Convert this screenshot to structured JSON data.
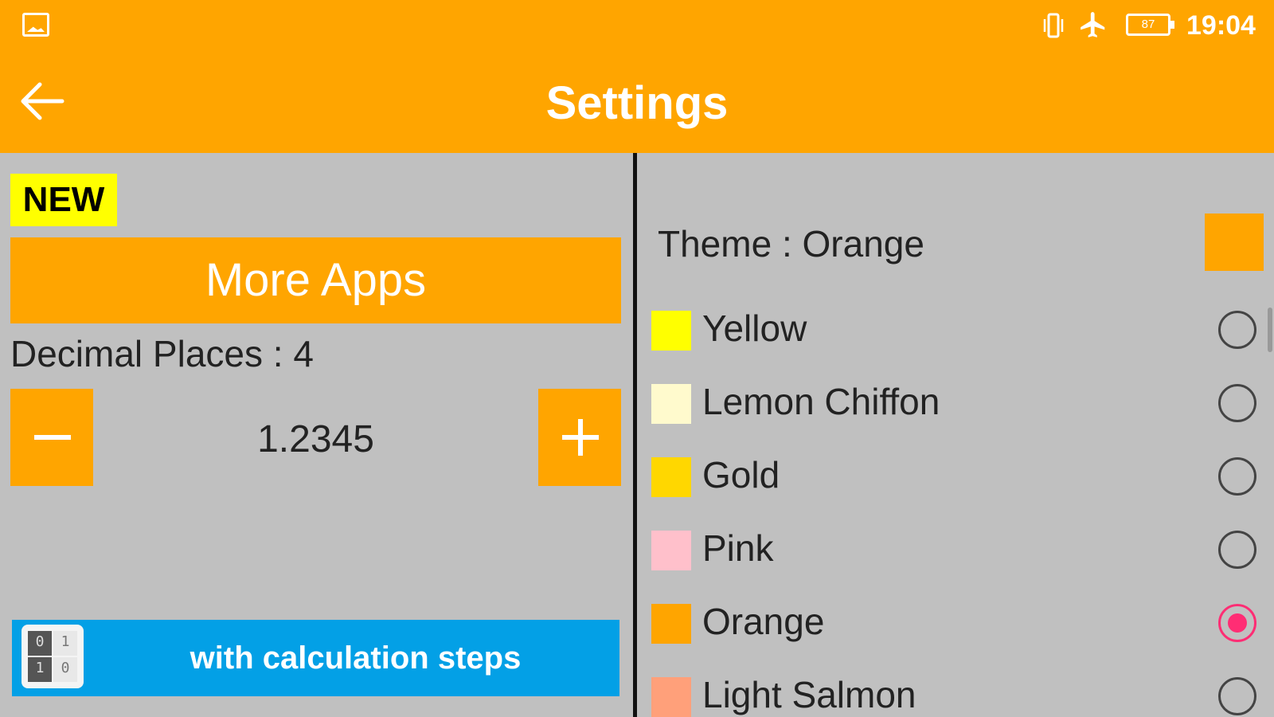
{
  "statusbar": {
    "battery": "87",
    "time": "19:04"
  },
  "appbar": {
    "title": "Settings"
  },
  "left": {
    "badge": "NEW",
    "more_apps": "More Apps",
    "decimal_label": "Decimal Places : 4",
    "example_value": "1.2345",
    "promo_text": "with calculation steps",
    "promo_icon_digits": [
      "0",
      "1",
      "1",
      "0"
    ]
  },
  "right": {
    "theme_label": "Theme : Orange",
    "theme_color": "#ffa500",
    "themes": [
      {
        "label": "Yellow",
        "color": "#ffff00",
        "selected": false
      },
      {
        "label": "Lemon Chiffon",
        "color": "#fffacd",
        "selected": false
      },
      {
        "label": "Gold",
        "color": "#ffd700",
        "selected": false
      },
      {
        "label": "Pink",
        "color": "#ffc0cb",
        "selected": false
      },
      {
        "label": "Orange",
        "color": "#ffa500",
        "selected": true
      },
      {
        "label": "Light Salmon",
        "color": "#ffa07a",
        "selected": false
      }
    ]
  },
  "colors": {
    "accent": "#ffa500",
    "background": "#c0c0c0",
    "promo": "#03a0e6",
    "radio_selected": "#ff2d74"
  },
  "icons": [
    "image-icon",
    "vibrate-icon",
    "airplane-icon",
    "battery-icon",
    "back-arrow-icon",
    "minus-icon",
    "plus-icon",
    "binary-app-icon"
  ]
}
